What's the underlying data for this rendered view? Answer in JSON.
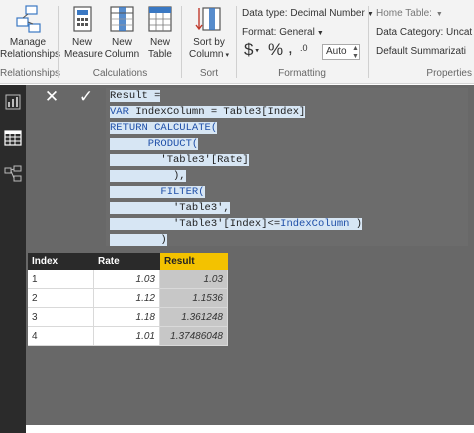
{
  "ribbon": {
    "relationships": {
      "manage_label_1": "Manage",
      "manage_label_2": "Relationships",
      "group_label": "Relationships"
    },
    "calculations": {
      "new_measure_1": "New",
      "new_measure_2": "Measure",
      "new_column_1": "New",
      "new_column_2": "Column",
      "new_table_1": "New",
      "new_table_2": "Table",
      "group_label": "Calculations"
    },
    "sort": {
      "sort_by_1": "Sort by",
      "sort_by_2": "Column",
      "group_label": "Sort"
    },
    "formatting": {
      "data_type": "Data type: Decimal Number",
      "format": "Format: General",
      "currency_symbol": "$",
      "percent_symbol": "%",
      "comma_symbol": ",",
      "auto_value": "Auto",
      "group_label": "Formatting"
    },
    "properties": {
      "home_table": "Home Table:",
      "data_category": "Data Category: Uncat",
      "default_summarization": "Default Summarizati",
      "group_label": "Properties"
    }
  },
  "formula_bar": {
    "cancel_glyph": "✕",
    "commit_glyph": "✓",
    "lines": [
      [
        {
          "t": "Result =",
          "c": "plain"
        }
      ],
      [
        {
          "t": "VAR ",
          "c": "blue"
        },
        {
          "t": "IndexColumn = Table3[Index]",
          "c": "plain"
        }
      ],
      [
        {
          "t": "RETURN CALCULATE(",
          "c": "blue"
        }
      ],
      [
        {
          "t": "      PRODUCT(",
          "c": "blue"
        }
      ],
      [
        {
          "t": "        'Table3'[Rate]",
          "c": "plain"
        }
      ],
      [
        {
          "t": "          ),",
          "c": "plain"
        }
      ],
      [
        {
          "t": "        FILTER(",
          "c": "blue"
        }
      ],
      [
        {
          "t": "          'Table3',",
          "c": "plain"
        }
      ],
      [
        {
          "t": "          'Table3'[Index]<=",
          "c": "plain"
        },
        {
          "t": "IndexColumn",
          "c": "blue"
        },
        {
          "t": " )",
          "c": "plain"
        }
      ],
      [
        {
          "t": "        )",
          "c": "plain"
        }
      ]
    ]
  },
  "table": {
    "headers": [
      "Index",
      "Rate",
      "Result"
    ],
    "rows": [
      [
        "1",
        "1.03",
        "1.03"
      ],
      [
        "2",
        "1.12",
        "1.1536"
      ],
      [
        "3",
        "1.18",
        "1.361248"
      ],
      [
        "4",
        "1.01",
        "1.37486048"
      ]
    ]
  },
  "colors": {
    "result_header": "#f3c200",
    "header_dark": "#2a2a2a",
    "workspace": "#686868",
    "rail": "#2b2b2b"
  },
  "icons": [
    "relationships-icon",
    "calculator-icon",
    "new-column-icon",
    "new-table-icon",
    "sort-by-column-icon",
    "report-view-icon",
    "data-view-icon",
    "model-view-icon"
  ]
}
